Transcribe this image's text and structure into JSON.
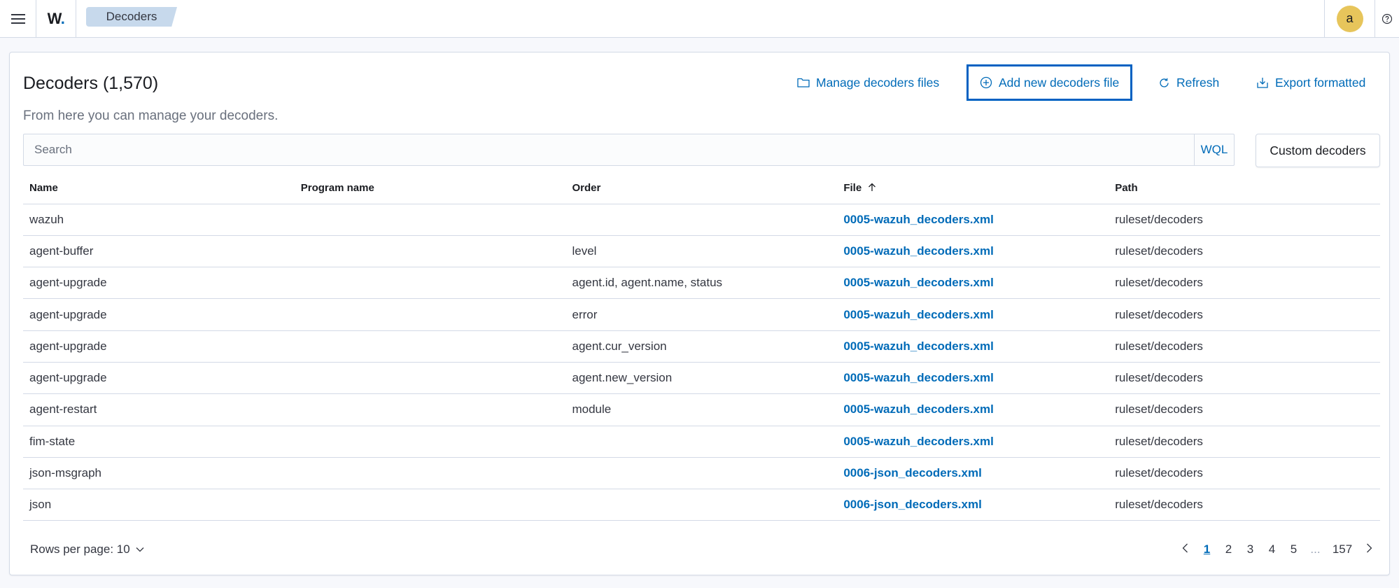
{
  "header": {
    "logo": "W",
    "breadcrumb": "Decoders",
    "avatar_letter": "a",
    "menu_icon": "hamburger-icon",
    "help_icon": "help-icon"
  },
  "page": {
    "title": "Decoders (1,570)",
    "subtitle": "From here you can manage your decoders."
  },
  "actions": {
    "manage": "Manage decoders files",
    "add": "Add new decoders file",
    "refresh": "Refresh",
    "export": "Export formatted"
  },
  "search": {
    "placeholder": "Search",
    "wql": "WQL",
    "custom_button": "Custom decoders"
  },
  "table": {
    "columns": [
      "Name",
      "Program name",
      "Order",
      "File",
      "Path"
    ],
    "sort_column": "File",
    "sort_icon": "arrow-up-icon",
    "rows": [
      {
        "name": "wazuh",
        "program": "",
        "order": "",
        "file": "0005-wazuh_decoders.xml",
        "path": "ruleset/decoders"
      },
      {
        "name": "agent-buffer",
        "program": "",
        "order": "level",
        "file": "0005-wazuh_decoders.xml",
        "path": "ruleset/decoders"
      },
      {
        "name": "agent-upgrade",
        "program": "",
        "order": "agent.id, agent.name, status",
        "file": "0005-wazuh_decoders.xml",
        "path": "ruleset/decoders"
      },
      {
        "name": "agent-upgrade",
        "program": "",
        "order": "error",
        "file": "0005-wazuh_decoders.xml",
        "path": "ruleset/decoders"
      },
      {
        "name": "agent-upgrade",
        "program": "",
        "order": "agent.cur_version",
        "file": "0005-wazuh_decoders.xml",
        "path": "ruleset/decoders"
      },
      {
        "name": "agent-upgrade",
        "program": "",
        "order": "agent.new_version",
        "file": "0005-wazuh_decoders.xml",
        "path": "ruleset/decoders"
      },
      {
        "name": "agent-restart",
        "program": "",
        "order": "module",
        "file": "0005-wazuh_decoders.xml",
        "path": "ruleset/decoders"
      },
      {
        "name": "fim-state",
        "program": "",
        "order": "",
        "file": "0005-wazuh_decoders.xml",
        "path": "ruleset/decoders"
      },
      {
        "name": "json-msgraph",
        "program": "",
        "order": "",
        "file": "0006-json_decoders.xml",
        "path": "ruleset/decoders"
      },
      {
        "name": "json",
        "program": "",
        "order": "",
        "file": "0006-json_decoders.xml",
        "path": "ruleset/decoders"
      }
    ]
  },
  "pagination": {
    "rows_per_page": "Rows per page: 10",
    "pages": [
      "1",
      "2",
      "3",
      "4",
      "5",
      "...",
      "157"
    ],
    "active_page": "1"
  },
  "colors": {
    "accent": "#006bb8",
    "avatar": "#e7c55b",
    "breadcrumb": "#c7d9ec"
  }
}
